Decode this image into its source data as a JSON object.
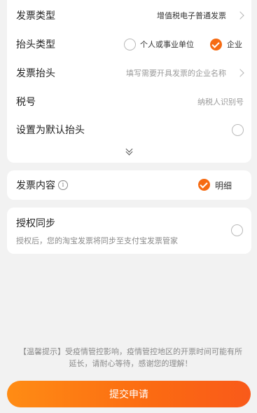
{
  "invoice": {
    "type_label": "发票类型",
    "type_value": "增值税电子普通发票",
    "header_type_label": "抬头类型",
    "header_type_options": [
      "个人或事业单位",
      "企业"
    ],
    "header_type_selected": "企业",
    "header_label": "发票抬头",
    "header_placeholder": "填写需要开具发票的企业名称",
    "tax_label": "税号",
    "tax_placeholder": "纳税人识别号",
    "default_label": "设置为默认抬头"
  },
  "content": {
    "label": "发票内容",
    "info_icon": "i",
    "option": "明细"
  },
  "sync": {
    "label": "授权同步",
    "description": "授权后，您的淘宝发票将同步至支付宝发票管家"
  },
  "notice": {
    "line1": "【温馨提示】受疫情管控影响，疫情管控地区的开票时间可能有所",
    "line2": "延长，请耐心等待，感谢您的理解！"
  },
  "submit_label": "提交申请",
  "colors": {
    "accent": "#f66b13",
    "background": "#f2f2f2"
  }
}
